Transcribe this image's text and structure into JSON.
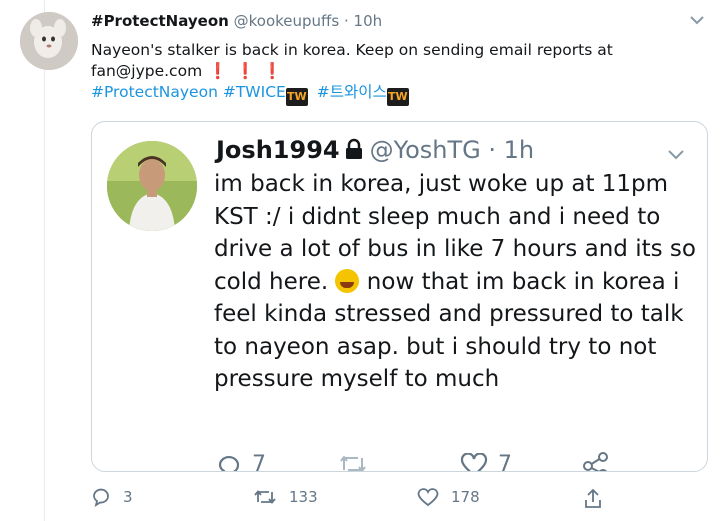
{
  "tweet": {
    "display_name": "#ProtectNayeon",
    "handle": "@kookeupuffs",
    "time": "10h",
    "text_line1": "Nayeon's stalker is back in korea. Keep on sending email reports at",
    "text_line2": "fan@jype.com",
    "exclamations": "❗❗❗",
    "hashtag1": "#ProtectNayeon",
    "hashtag2": "#TWICE",
    "hashtag3": "#트와이스",
    "reply_count": "3",
    "retweet_count": "133",
    "like_count": "178"
  },
  "quoted": {
    "display_name": "Josh1994",
    "handle": "@YoshTG",
    "time": "1h",
    "lines": [
      "im back in korea, just woke up at 11pm",
      "KST :/ i didnt sleep much and i need to",
      "drive a lot of bus in like 7 hours and its so",
      "cold here.",
      " now that im back in korea i",
      "feel kinda stressed and pressured to talk",
      "to nayeon asap. but i should try to not",
      "pressure myself to much"
    ],
    "reply_count": "7",
    "like_count": "7"
  },
  "icons": {
    "caret": "chevron-down-icon",
    "lock": "lock-icon",
    "reply": "reply-icon",
    "retweet": "retweet-icon",
    "like": "heart-icon",
    "share": "share-icon"
  },
  "colors": {
    "link": "#1b95e0",
    "muted": "#657786",
    "border": "#ccd6dd",
    "exclamation": "#d0021b"
  }
}
